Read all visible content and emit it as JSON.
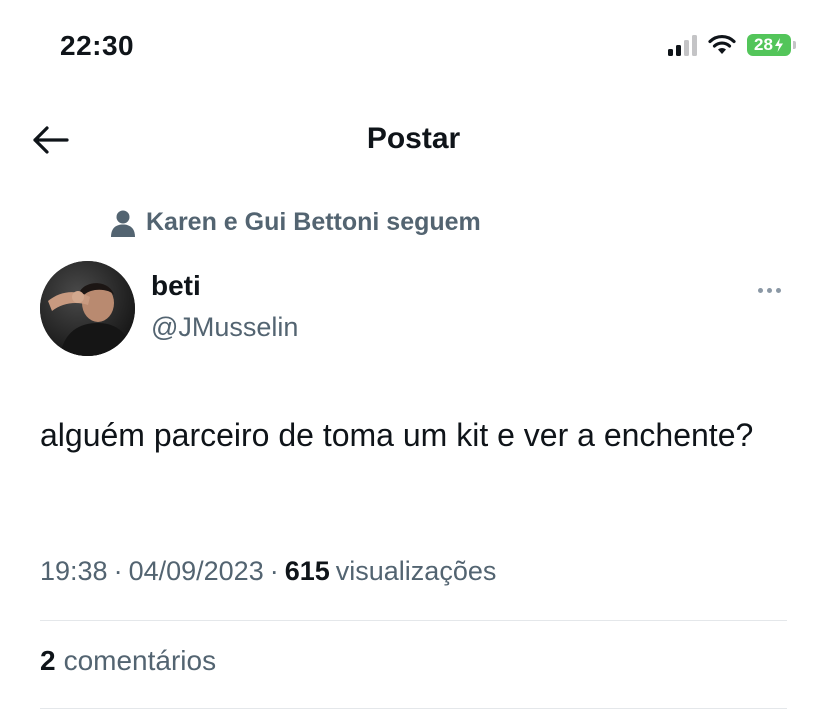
{
  "status_bar": {
    "time": "22:30",
    "battery": "28",
    "icons": [
      "signal-icon",
      "wifi-icon",
      "battery-icon"
    ],
    "signal_level": "2 of 4 bars"
  },
  "header": {
    "title": "Postar",
    "back_icon": "arrow-left-icon"
  },
  "post": {
    "social_context": "Karen e Gui Bettoni seguem",
    "social_icon": "person-icon",
    "author": {
      "name": "beti",
      "handle": "@JMusselin"
    },
    "more_icon": "more-horizontal-icon",
    "text": "alguém parceiro de toma um kit e ver a enchente?",
    "time": "19:38",
    "date": "04/09/2023",
    "separator": "·",
    "views_count": "615",
    "views_label": "visualizações",
    "comments_count": "2",
    "comments_label": "comentários"
  },
  "colors": {
    "text_primary": "#0f1419",
    "text_secondary": "#536471",
    "divider": "#e4e7ea",
    "battery_green": "#53c55a"
  }
}
